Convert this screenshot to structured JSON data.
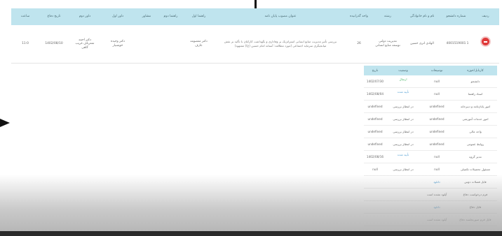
{
  "table": {
    "headers": {
      "row": "ردیف",
      "student_no": "شماره دانشجو",
      "name": "نام و نام خانوادگی",
      "field": "رشته",
      "units": "واحد گذرانیده",
      "title": "عنوان مصوب پایان نامه",
      "advisor1": "راهنما اول",
      "advisor2": "راهنما دوم",
      "consultant": "مشاور",
      "referee1": "داور اول",
      "referee2": "داور دوم",
      "defense_date": "تاریخ دفاع",
      "hour": "ساعت"
    },
    "row": {
      "row": "1",
      "student_no": "4001519001",
      "name": "الهادي اترى حسين",
      "field": "مدیریت دولتی توسعه منابع انسانی",
      "units": "26",
      "title": "بررسی تأثیر مدیریت منابع انسانی استراتژیک بر وفاداری و نگهداشت کارکنان با تأکید بر نقش میانجیگری سرمایه اجتماعی (مورد مطالعه: آستانه امام حسین (ع)) مشهود)",
      "advisor1": "دکتر معصومه عارف",
      "advisor2": "",
      "consultant": "",
      "referee1": "دکتر وحیده خوشنیار",
      "referee2": "دکتر احمد شعرباف غریب گاهی",
      "defense_date": "1402/08/10",
      "hour": "11:0"
    }
  },
  "subtable": {
    "headers": {
      "task": "کارتابل/حوزه",
      "desc": "توضیحات",
      "status": "وضعیت",
      "date": "تاریخ"
    },
    "rows": [
      {
        "task": "دانشجو",
        "desc": "null",
        "status": "ارسال",
        "date": "1402/07/30",
        "status_color": "green"
      },
      {
        "task": "استاد راهنما",
        "desc": "null",
        "status": "تأیید شده",
        "date": "1402/08/04",
        "status_color": "blue"
      },
      {
        "task": "امور پایان‌نامه و دبیرخانه",
        "desc": "undefined",
        "status": "در انتظار بررسی",
        "date": "undefined",
        "status_color": "gray"
      },
      {
        "task": "امور خدمات آموزشی",
        "desc": "undefined",
        "status": "در انتظار بررسی",
        "date": "undefined",
        "status_color": "gray"
      },
      {
        "task": "واحد مالی",
        "desc": "undefined",
        "status": "در انتظار بررسی",
        "date": "undefined",
        "status_color": "gray"
      },
      {
        "task": "روابط عمومی",
        "desc": "undefined",
        "status": "در انتظار بررسی",
        "date": "undefined",
        "status_color": "gray"
      },
      {
        "task": "مدیر گروه",
        "desc": "null",
        "status": "تأیید شده",
        "date": "1402/08/16",
        "status_color": "blue"
      },
      {
        "task": "مسئول تحصیلات تکمیلی",
        "desc": "null",
        "status": "در انتظار بررسی",
        "date": "null",
        "status_color": "gray"
      },
      {
        "task": "فایل فصلات دوس",
        "desc": "دانلود",
        "status": "",
        "date": "",
        "status_color": "link"
      },
      {
        "task": "فرم درخواست دفاع",
        "desc": "آپلود نشده است",
        "status": "",
        "date": "",
        "status_color": "gray"
      },
      {
        "task": "فایل دفاع",
        "desc": "دانلود",
        "status": "",
        "date": "",
        "status_color": "link"
      },
      {
        "task": "فایل فرم صورتجلسه دفاع",
        "desc": "آپلود نشده است",
        "status": "",
        "date": "",
        "status_color": "gray"
      }
    ]
  },
  "colors": {
    "header_bg": "#bfe4ee",
    "action_red": "#e03a3a",
    "status_green": "#4ab86a",
    "status_blue": "#5aa4d6",
    "link": "#4a9ad0"
  }
}
